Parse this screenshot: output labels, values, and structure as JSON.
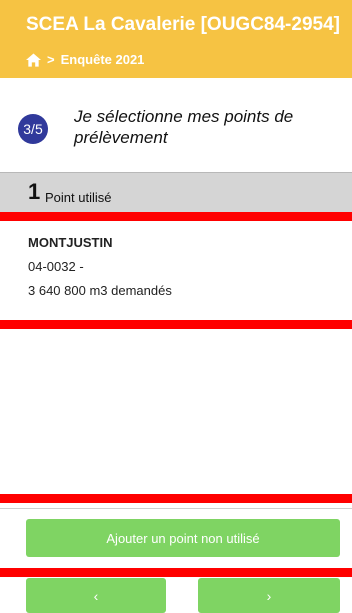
{
  "header": {
    "title": "SCEA La Cavalerie [OUGC84-2954]",
    "breadcrumb_sep": ">",
    "breadcrumb_item": "Enquête 2021"
  },
  "step": {
    "badge": "3/5",
    "text": "Je sélectionne mes points de prélèvement"
  },
  "section": {
    "count": "1",
    "label": "Point utilisé"
  },
  "points": [
    {
      "name": "MONTJUSTIN",
      "code": "04-0032 -",
      "volume": "3 640 800 m3 demandés"
    }
  ],
  "actions": {
    "add_label": "Ajouter un point non utilisé",
    "prev_label": "‹",
    "next_label": "›"
  },
  "colors": {
    "header": "#f6c343",
    "badge": "#30399b",
    "button": "#7fd463",
    "highlight": "#ff0000"
  },
  "icons": {
    "home": "home-icon"
  }
}
